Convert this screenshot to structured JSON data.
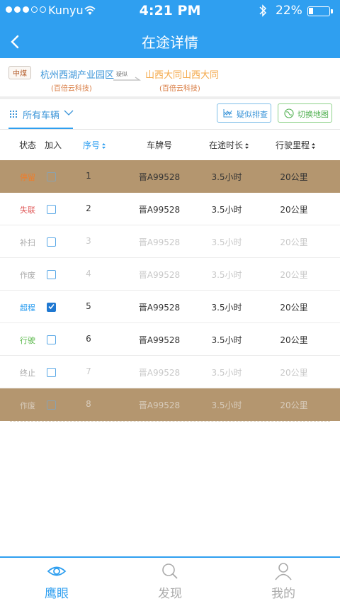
{
  "status_bar": {
    "carrier": "Kunyu",
    "time": "4:21 PM",
    "battery": "22%"
  },
  "nav": {
    "title": "在途详情"
  },
  "route": {
    "tag": "中煤",
    "from": "杭州西湖产业园区",
    "from_sub": "(百倍云科技)",
    "mid": "疑似",
    "to": "山西大同山西大同",
    "to_sub": "(百倍云科技)"
  },
  "filter": {
    "label": "所有车辆",
    "suspect_btn": "疑似排查",
    "map_btn": "切换地图"
  },
  "table": {
    "headers": {
      "status": "状态",
      "join": "加入",
      "seq": "序号",
      "plate": "车牌号",
      "duration": "在途时长",
      "mileage": "行驶里程"
    },
    "rows": [
      {
        "status": "停留",
        "checked": false,
        "seq": "1",
        "plate": "晋A99528",
        "duration": "3.5小时",
        "mileage": "20公里"
      },
      {
        "status": "失联",
        "checked": false,
        "seq": "2",
        "plate": "晋A99528",
        "duration": "3.5小时",
        "mileage": "20公里"
      },
      {
        "status": "补扫",
        "checked": false,
        "seq": "3",
        "plate": "晋A99528",
        "duration": "3.5小时",
        "mileage": "20公里"
      },
      {
        "status": "作废",
        "checked": false,
        "seq": "4",
        "plate": "晋A99528",
        "duration": "3.5小时",
        "mileage": "20公里"
      },
      {
        "status": "超程",
        "checked": true,
        "seq": "5",
        "plate": "晋A99528",
        "duration": "3.5小时",
        "mileage": "20公里"
      },
      {
        "status": "行驶",
        "checked": false,
        "seq": "6",
        "plate": "晋A99528",
        "duration": "3.5小时",
        "mileage": "20公里"
      },
      {
        "status": "终止",
        "checked": false,
        "seq": "7",
        "plate": "晋A99528",
        "duration": "3.5小时",
        "mileage": "20公里"
      },
      {
        "status": "作废",
        "checked": false,
        "seq": "8",
        "plate": "晋A99528",
        "duration": "3.5小时",
        "mileage": "20公里"
      }
    ]
  },
  "tabbar": {
    "tab1": "鹰眼",
    "tab2": "发现",
    "tab3": "我的"
  },
  "colors": {
    "primary": "#2f9ff0",
    "highlight_row": "#b4966f",
    "status_stay": "#f07c28",
    "status_lost": "#e05a5a",
    "status_over": "#2f9ff0",
    "status_drive": "#5ab84b",
    "status_dim": "#aaaaaa"
  }
}
